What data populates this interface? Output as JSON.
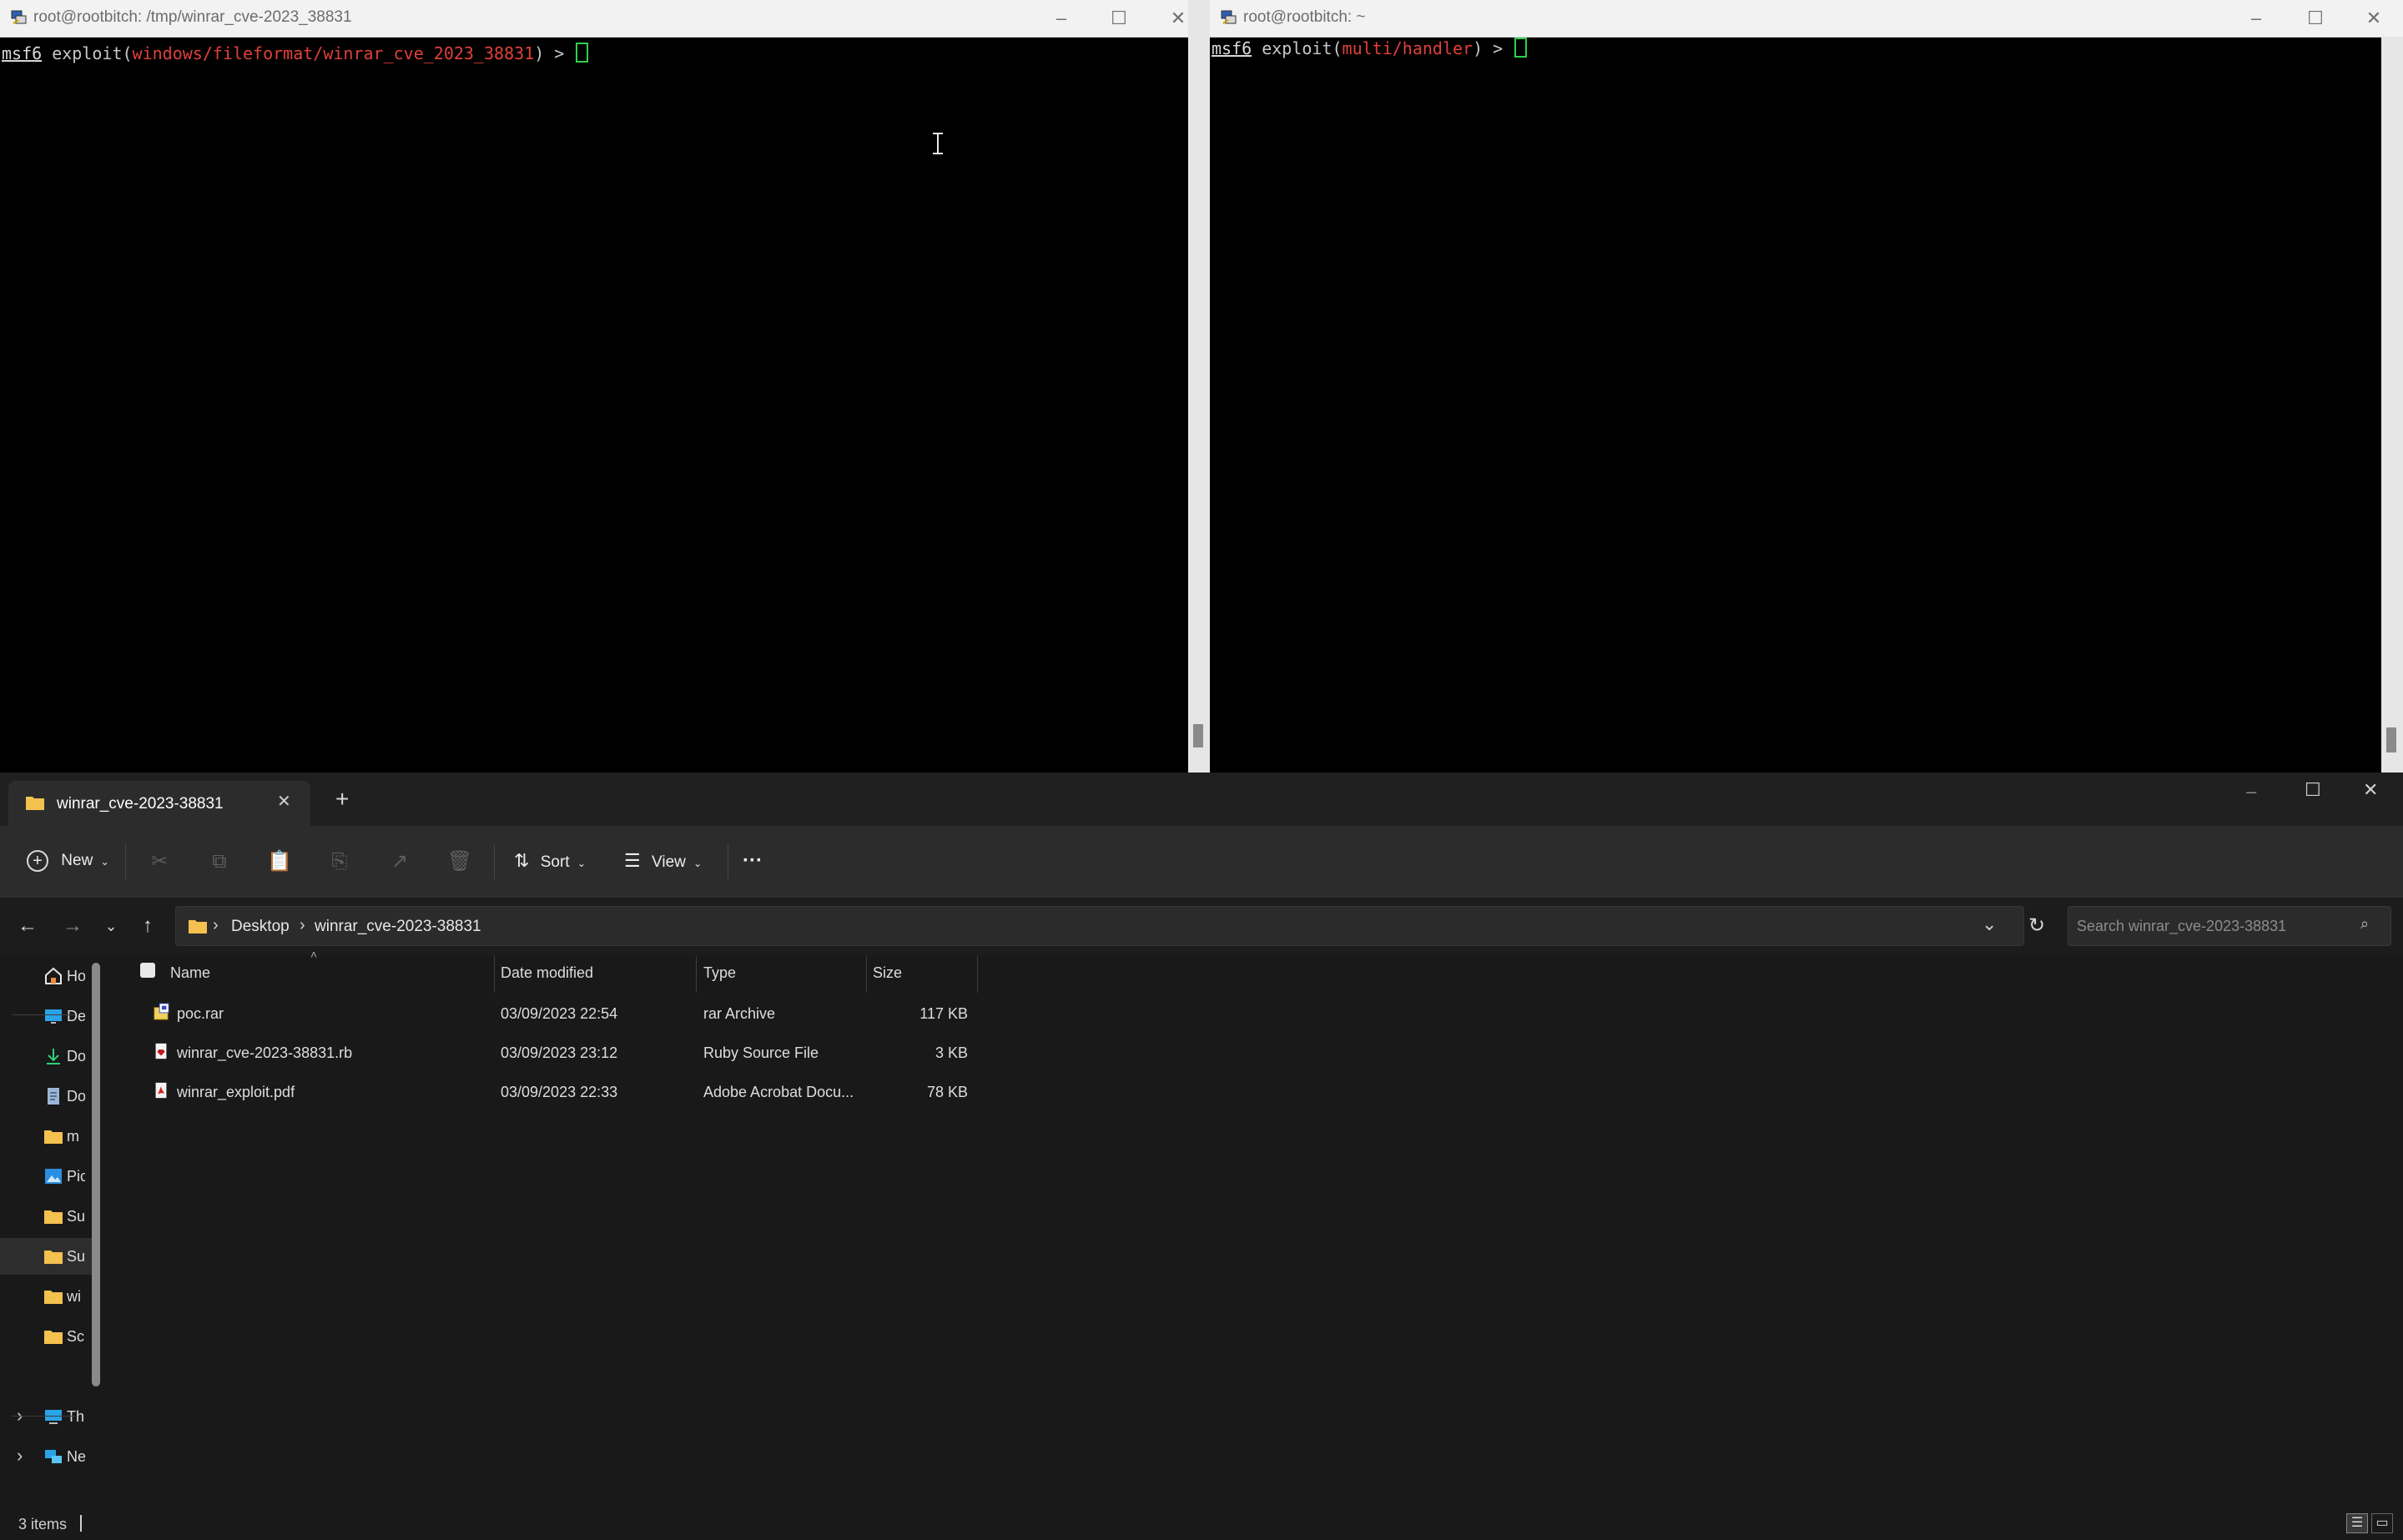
{
  "terminal_left": {
    "title": "root@rootbitch: /tmp/winrar_cve-2023_38831",
    "prompt_msf": "msf6",
    "prompt_cmd": "exploit(",
    "prompt_module": "windows/fileformat/winrar_cve_2023_38831",
    "prompt_end": ") > "
  },
  "terminal_right": {
    "title": "root@rootbitch: ~",
    "prompt_msf": "msf6",
    "prompt_cmd": "exploit(",
    "prompt_module": "multi/handler",
    "prompt_end": ") > "
  },
  "explorer": {
    "tab_title": "winrar_cve-2023-38831",
    "toolbar": {
      "new_label": "New",
      "sort_label": "Sort",
      "view_label": "View",
      "more_label": "···"
    },
    "address": {
      "crumb1": "Desktop",
      "crumb2": "winrar_cve-2023-38831",
      "separator": "›"
    },
    "search_placeholder": "Search winrar_cve-2023-38831",
    "nav_items": [
      {
        "label": "Ho",
        "icon": "home-icon"
      },
      {
        "label": "De",
        "icon": "desktop-icon"
      },
      {
        "label": "Do",
        "icon": "download-icon"
      },
      {
        "label": "Do",
        "icon": "documents-icon"
      },
      {
        "label": "m",
        "icon": "folder-icon"
      },
      {
        "label": "Pic",
        "icon": "pictures-icon"
      },
      {
        "label": "Su",
        "icon": "folder-icon"
      },
      {
        "label": "Su",
        "icon": "folder-icon"
      },
      {
        "label": "wi",
        "icon": "folder-icon"
      },
      {
        "label": "Sc",
        "icon": "folder-icon"
      },
      {
        "label": "Th",
        "icon": "this-pc-icon"
      },
      {
        "label": "Ne",
        "icon": "network-icon"
      }
    ],
    "columns": {
      "name": "Name",
      "date": "Date modified",
      "type": "Type",
      "size": "Size"
    },
    "files": [
      {
        "name": "poc.rar",
        "date": "03/09/2023 22:54",
        "type": "rar Archive",
        "size": "117 KB",
        "icon": "rar-archive-icon"
      },
      {
        "name": "winrar_cve-2023-38831.rb",
        "date": "03/09/2023 23:12",
        "type": "Ruby Source File",
        "size": "3 KB",
        "icon": "ruby-file-icon"
      },
      {
        "name": "winrar_exploit.pdf",
        "date": "03/09/2023 22:33",
        "type": "Adobe Acrobat Docu...",
        "size": "78 KB",
        "icon": "pdf-file-icon"
      }
    ],
    "status_text": "3 items",
    "colors": {
      "accent": "#2fd04a",
      "module_red": "#e0403a",
      "folder_yellow": "#f4c04e"
    }
  }
}
